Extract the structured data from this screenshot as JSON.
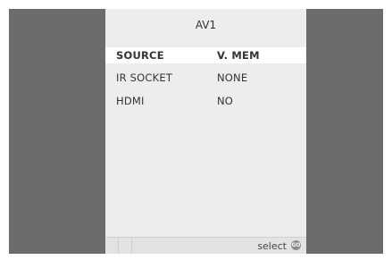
{
  "menu": {
    "title": "AV1",
    "items": [
      {
        "label": "SOURCE",
        "value": "V. MEM",
        "selected": true
      },
      {
        "label": "IR  SOCKET",
        "value": "NONE",
        "selected": false
      },
      {
        "label": "HDMI",
        "value": "NO",
        "selected": false
      }
    ]
  },
  "footer": {
    "hint": "select",
    "button_icon": "go-button-icon",
    "button_glyph": "GO"
  },
  "colors": {
    "background": "#6b6b6b",
    "panel": "#ededed",
    "selected_row": "#ffffff",
    "text": "#333333"
  }
}
